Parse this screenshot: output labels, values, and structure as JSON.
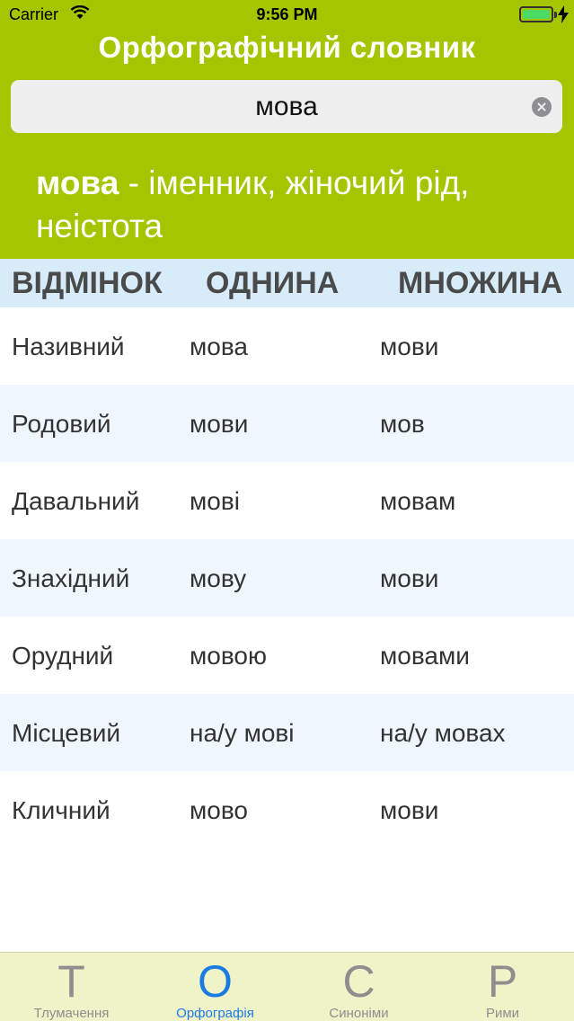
{
  "status_bar": {
    "carrier": "Carrier",
    "time": "9:56 PM",
    "battery_level": 1.0
  },
  "header": {
    "title": "Орфографічний словник"
  },
  "search": {
    "value": "мова"
  },
  "definition": {
    "word": "мова",
    "text": " - іменник, жіночий рід, неістота"
  },
  "table": {
    "headers": [
      "ВІДМІНОК",
      "ОДНИНА",
      "МНОЖИНА"
    ],
    "rows": [
      [
        "Називний",
        "мова",
        "мови"
      ],
      [
        "Родовий",
        "мови",
        "мов"
      ],
      [
        "Давальний",
        "мові",
        "мовам"
      ],
      [
        "Знахідний",
        "мову",
        "мови"
      ],
      [
        "Орудний",
        "мовою",
        "мовами"
      ],
      [
        "Місцевий",
        "на/у мові",
        "на/у мовах"
      ],
      [
        "Кличний",
        "мово",
        "мови"
      ]
    ]
  },
  "tabs": [
    {
      "glyph": "Т",
      "label": "Тлумачення",
      "active": false
    },
    {
      "glyph": "О",
      "label": "Орфографія",
      "active": true
    },
    {
      "glyph": "С",
      "label": "Синоніми",
      "active": false
    },
    {
      "glyph": "Р",
      "label": "Рими",
      "active": false
    }
  ],
  "colors": {
    "header_green": "#a5c500",
    "table_header_bg": "#d7ebf9",
    "row_alt_bg": "#eff6fd",
    "tab_active": "#1a7be2",
    "tabbar_bg": "#f0f3c8"
  },
  "icons": [
    "wifi-icon",
    "battery-icon",
    "charging-icon",
    "clear-icon"
  ]
}
